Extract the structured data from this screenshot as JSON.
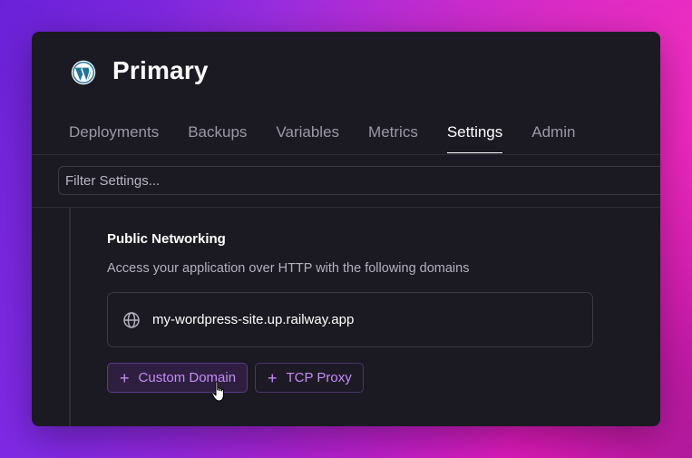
{
  "project": {
    "logo_icon": "wordpress-icon",
    "title": "Primary"
  },
  "tabs": [
    {
      "label": "Deployments",
      "active": false
    },
    {
      "label": "Backups",
      "active": false
    },
    {
      "label": "Variables",
      "active": false
    },
    {
      "label": "Metrics",
      "active": false
    },
    {
      "label": "Settings",
      "active": true
    },
    {
      "label": "Admin",
      "active": false
    }
  ],
  "filter": {
    "placeholder": "Filter Settings...",
    "value": ""
  },
  "networking": {
    "title": "Public Networking",
    "description": "Access your application over HTTP with the following domains",
    "domain_icon": "globe-icon",
    "domain": "my-wordpress-site.up.railway.app",
    "custom_domain_label": "Custom Domain",
    "tcp_proxy_label": "TCP Proxy"
  },
  "colors": {
    "accent": "#c58cf5",
    "panel": "#1b1a23"
  }
}
